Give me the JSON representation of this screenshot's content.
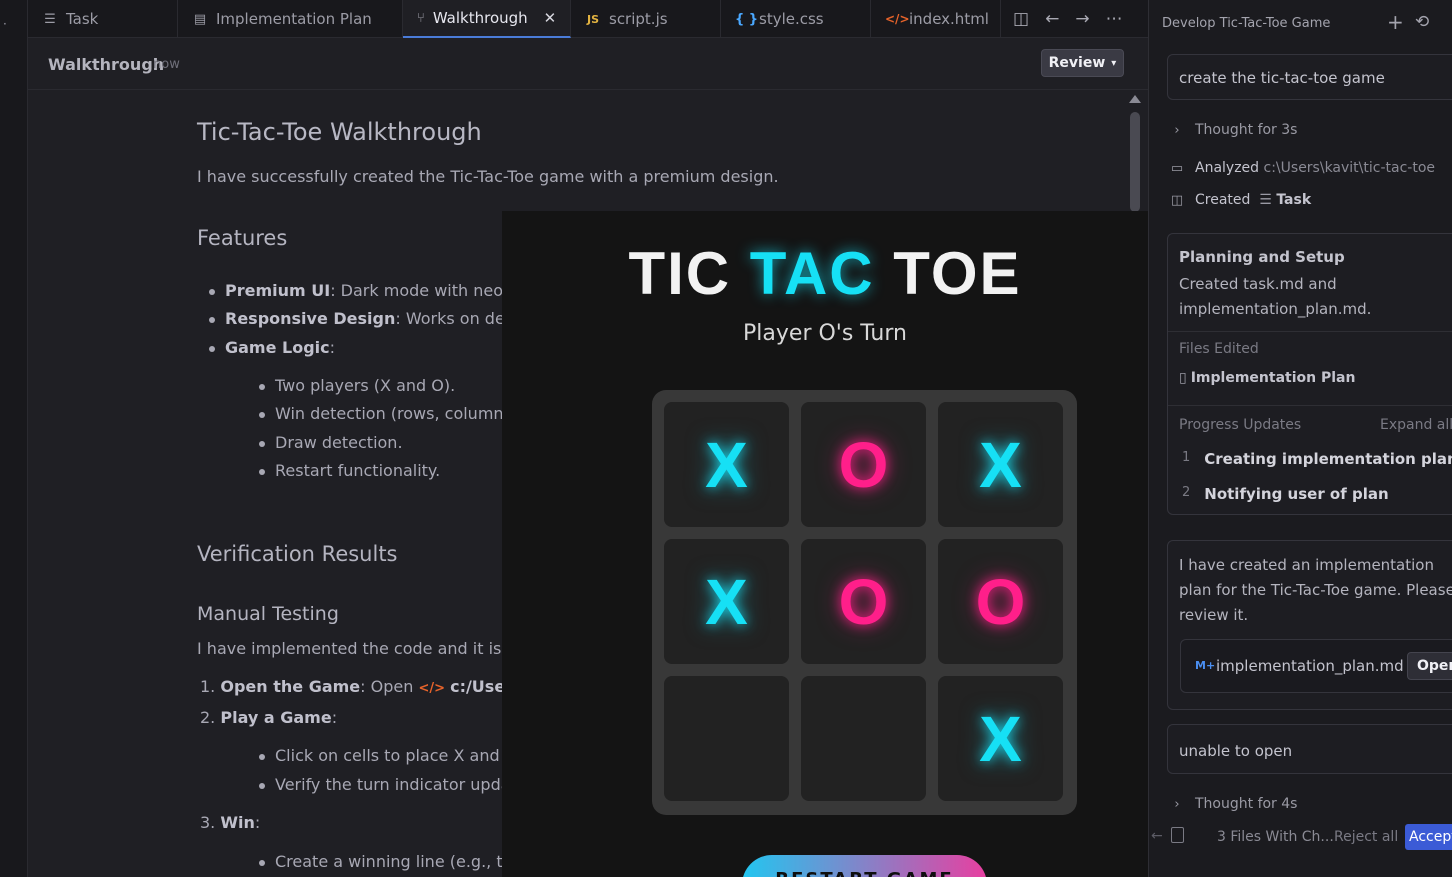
{
  "tabs": [
    {
      "label": "Task",
      "icon": "checklist-icon"
    },
    {
      "label": "Implementation Plan",
      "icon": "file-icon"
    },
    {
      "label": "Walkthrough",
      "icon": "git-compare-icon",
      "active": true
    },
    {
      "label": "script.js",
      "icon": "js-icon",
      "badge": "JS"
    },
    {
      "label": "style.css",
      "icon": "css-icon",
      "badge": "{ }"
    },
    {
      "label": "index.html",
      "icon": "html-icon",
      "badge": "</>"
    }
  ],
  "editor": {
    "title": "Walkthrough",
    "time": "now",
    "review_label": "Review"
  },
  "doc": {
    "h1": "Tic-Tac-Toe Walkthrough",
    "intro": "I have successfully created the Tic-Tac-Toe game with a premium design.",
    "features_heading": "Features",
    "features": [
      {
        "bold": "Premium UI",
        "rest": ": Dark mode with neon c"
      },
      {
        "bold": "Responsive Design",
        "rest": ": Works on deskto"
      },
      {
        "bold": "Game Logic",
        "rest": ":"
      }
    ],
    "logic_items": [
      "Two players (X and O).",
      "Win detection (rows, columns,",
      "Draw detection.",
      "Restart functionality."
    ],
    "verification_heading": "Verification Results",
    "manual_heading": "Manual Testing",
    "manual_text": "I have implemented the code and it is re",
    "steps": [
      {
        "num": "1.",
        "bold": "Open the Game",
        "rest": ": Open ",
        "path": "c:/Users/k"
      },
      {
        "num": "2.",
        "bold": "Play a Game",
        "rest": ":"
      },
      {
        "num": "3.",
        "bold": "Win",
        "rest": ":"
      }
    ],
    "play_items": [
      "Click on cells to place X and O.",
      "Verify the turn indicator update"
    ],
    "win_items": [
      "Create a winning line (e.g., top"
    ]
  },
  "game": {
    "title_left": "TIC",
    "title_mid": "TAC",
    "title_right": "TOE",
    "turn": "Player O's Turn",
    "board": [
      "X",
      "O",
      "X",
      "X",
      "O",
      "O",
      "",
      "",
      "X"
    ],
    "restart_label": "RESTART GAME",
    "colors": {
      "x": "#16e0f5",
      "o": "#ff1f8a"
    }
  },
  "panel": {
    "title": "Develop Tic-Tac-Toe Game",
    "user_msg_1": "create the tic-tac-toe game",
    "thought_1": "Thought for 3s",
    "analyzed_label": "Analyzed",
    "analyzed_path": "c:\\Users\\kavit\\tic-tac-toe",
    "created_label": "Created",
    "created_item": "Task",
    "planning_title": "Planning and Setup",
    "planning_body": "Created task.md and implementation_plan.md.",
    "files_edited_label": "Files Edited",
    "files_edited_item": "Implementation Plan",
    "progress_label": "Progress Updates",
    "expand_label": "Expand all",
    "progress_steps": [
      {
        "num": "1",
        "label": "Creating implementation plan"
      },
      {
        "num": "2",
        "label": "Notifying user of plan"
      }
    ],
    "agent_msg": "I have created an implementation plan for the Tic-Tac-Toe game. Please review it.",
    "file_chip_badge": "M+",
    "file_chip_name": "implementation_plan.md",
    "open_label": "Open",
    "user_msg_2": "unable to open",
    "thought_2": "Thought for 4s",
    "files_changed": "3 Files With Ch...",
    "reject_label": "Reject all",
    "accept_label": "Accept"
  }
}
